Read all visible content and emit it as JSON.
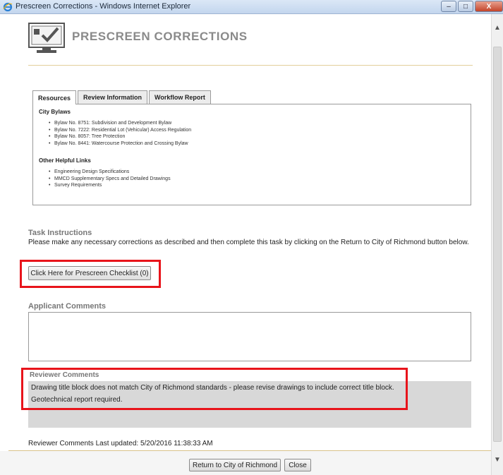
{
  "window": {
    "title": "Prescreen Corrections - Windows Internet Explorer",
    "minimize_label": "–",
    "maximize_label": "□",
    "close_label": "X"
  },
  "header": {
    "title": "PRESCREEN CORRECTIONS"
  },
  "tabs": [
    {
      "label": "Resources",
      "active": true
    },
    {
      "label": "Review Information",
      "active": false
    },
    {
      "label": "Workflow Report",
      "active": false
    }
  ],
  "resources": {
    "city_bylaws_heading": "City Bylaws",
    "city_bylaws": [
      "Bylaw No. 8751: Subdivision and Development Bylaw",
      "Bylaw No. 7222: Residential Lot (Vehicular) Access Regulation",
      "Bylaw No. 8057: Tree Protection",
      "Bylaw No. 8441: Watercourse Protection and Crossing Bylaw"
    ],
    "other_links_heading": "Other Helpful Links",
    "other_links": [
      "Engineering Design Specifications",
      "MMCD Supplementary Specs and Detailed Drawings",
      "Survey Requirements"
    ]
  },
  "task": {
    "heading": "Task Instructions",
    "text": "Please make any necessary corrections as described and then complete this task by clicking on the Return to City of Richmond button below.",
    "checklist_button": "Click Here for Prescreen Checklist (0)"
  },
  "applicant": {
    "heading": "Applicant Comments",
    "value": ""
  },
  "reviewer": {
    "heading": "Reviewer Comments",
    "lines": [
      "Drawing title block does not match City of Richmond standards - please revise drawings to include correct title block.",
      "Geotechnical report required."
    ],
    "updated": "Reviewer Comments Last updated: 5/20/2016 11:38:33 AM"
  },
  "footer": {
    "return_button": "Return to City of Richmond",
    "close_button": "Close"
  },
  "colors": {
    "highlight": "#e8141b",
    "title_grey": "#8a8a8a",
    "rule_gold": "#e2cf9a"
  }
}
